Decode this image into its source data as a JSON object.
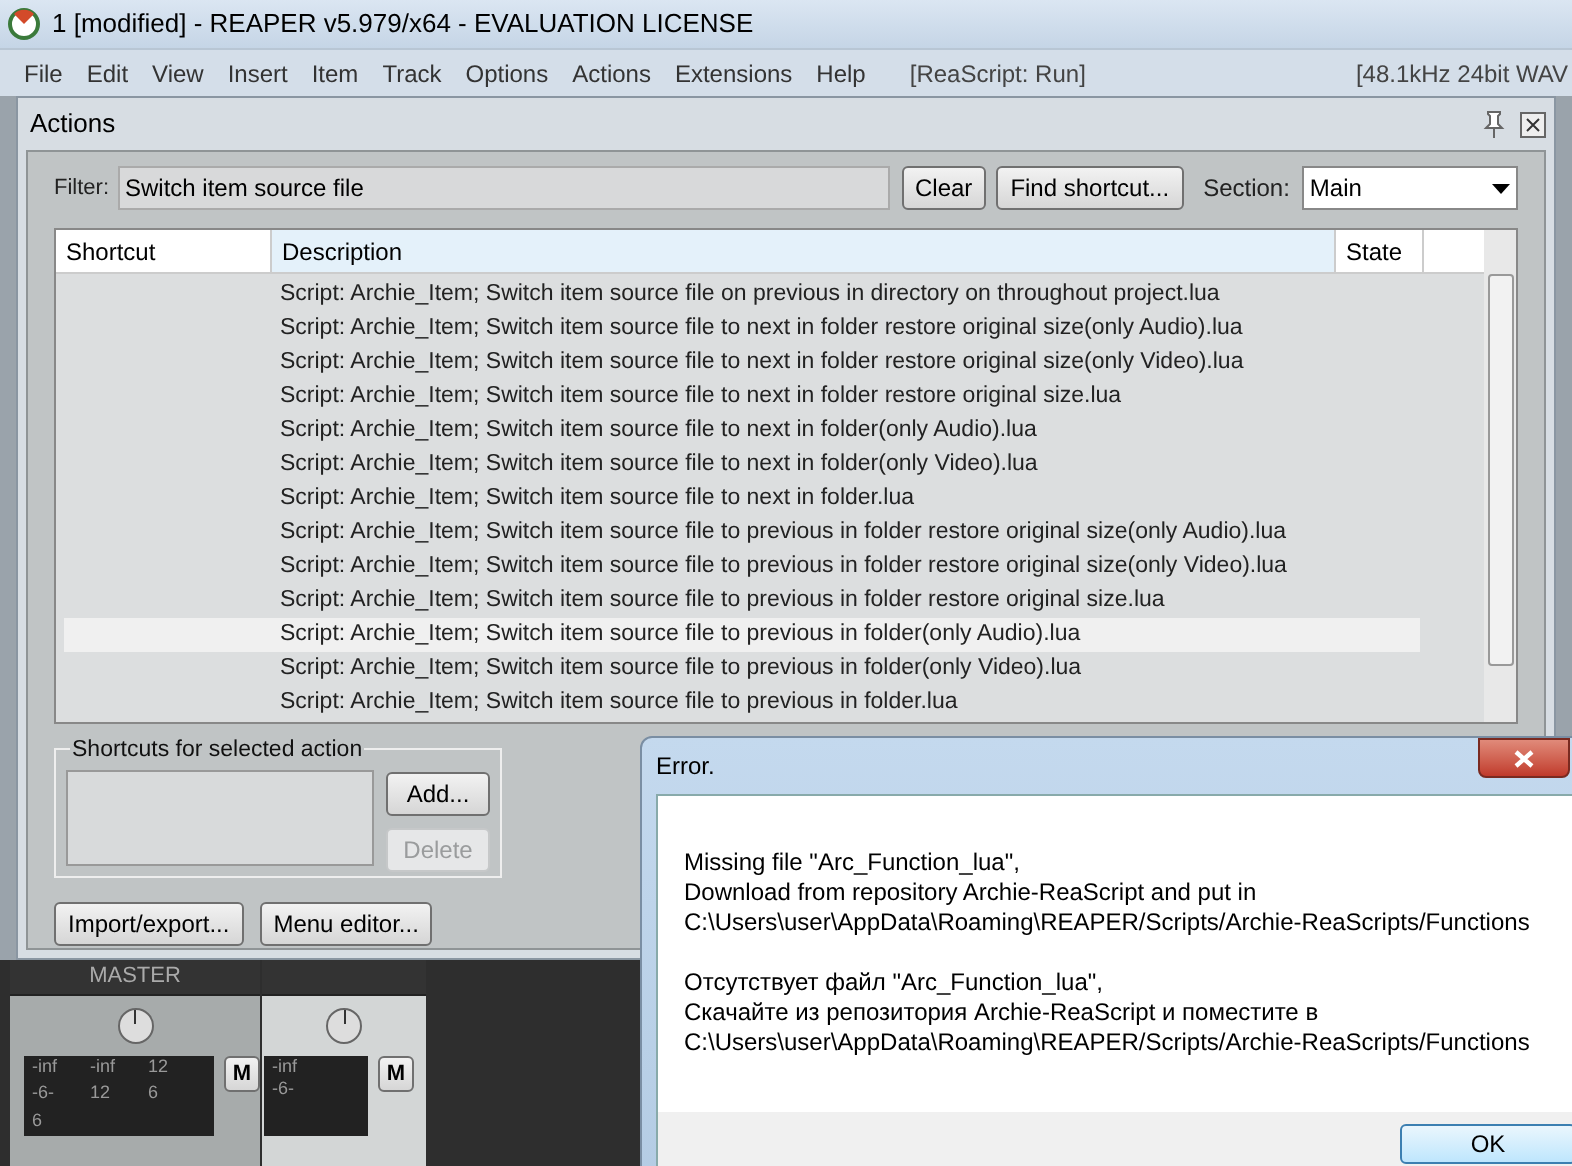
{
  "window": {
    "title": "1 [modified] - REAPER v5.979/x64 - EVALUATION LICENSE"
  },
  "menu": [
    "File",
    "Edit",
    "View",
    "Insert",
    "Item",
    "Track",
    "Options",
    "Actions",
    "Extensions",
    "Help"
  ],
  "menu_status": "[ReaScript: Run]",
  "audio_status": "[48.1kHz 24bit WAV",
  "actions": {
    "title": "Actions",
    "filter_label": "Filter:",
    "filter_value": "Switch item source file",
    "clear": "Clear",
    "find_shortcut": "Find shortcut...",
    "section_label": "Section:",
    "section_value": "Main",
    "columns": [
      "Shortcut",
      "Description",
      "State"
    ],
    "rows": [
      {
        "description": "Script: Archie_Item;  Switch item source file on previous in directory on throughout project.lua",
        "selected": false
      },
      {
        "description": "Script: Archie_Item;  Switch item source file to next in folder restore original size(only Audio).lua",
        "selected": false
      },
      {
        "description": "Script: Archie_Item;  Switch item source file to next in folder restore original size(only Video).lua",
        "selected": false
      },
      {
        "description": "Script: Archie_Item;  Switch item source file to next in folder restore original size.lua",
        "selected": false
      },
      {
        "description": "Script: Archie_Item;  Switch item source file to next in folder(only Audio).lua",
        "selected": false
      },
      {
        "description": "Script: Archie_Item;  Switch item source file to next in folder(only Video).lua",
        "selected": false
      },
      {
        "description": "Script: Archie_Item;  Switch item source file to next in folder.lua",
        "selected": false
      },
      {
        "description": "Script: Archie_Item;  Switch item source file to previous in folder restore original size(only Audio).lua",
        "selected": false
      },
      {
        "description": "Script: Archie_Item;  Switch item source file to previous in folder restore original size(only Video).lua",
        "selected": false
      },
      {
        "description": "Script: Archie_Item;  Switch item source file to previous in folder restore original size.lua",
        "selected": false
      },
      {
        "description": "Script: Archie_Item;  Switch item source file to previous in folder(only Audio).lua",
        "selected": true
      },
      {
        "description": "Script: Archie_Item;  Switch item source file to previous in folder(only Video).lua",
        "selected": false
      },
      {
        "description": "Script: Archie_Item;  Switch item source file to previous in folder.lua",
        "selected": false
      }
    ],
    "shortcuts_group": "Shortcuts for selected action",
    "add": {
      "label": "Add...",
      "disabled": false
    },
    "delete": {
      "label": "Delete",
      "disabled": true
    },
    "import_export": "Import/export...",
    "menu_editor": "Menu editor..."
  },
  "mixer": {
    "master_label": "MASTER",
    "master_meter": [
      "-inf",
      "-inf",
      "12",
      "-6-",
      "12",
      "6",
      "6"
    ],
    "master_mute": "M",
    "track_meter": [
      "-inf",
      "-6-"
    ],
    "track_mute": "M"
  },
  "error_dialog": {
    "title": "Error.",
    "paragraphs": [
      [
        "Missing file \"Arc_Function_lua\",",
        "Download from repository Archie-ReaScript and put in",
        "C:\\Users\\user\\AppData\\Roaming\\REAPER/Scripts/Archie-ReaScripts/Functions"
      ],
      [
        "Отсутствует файл \"Arc_Function_lua\",",
        "Скачайте из репозитория Archie-ReaScript и поместите в",
        "C:\\Users\\user\\AppData\\Roaming\\REAPER/Scripts/Archie-ReaScripts/Functions"
      ]
    ],
    "ok": "OK"
  }
}
